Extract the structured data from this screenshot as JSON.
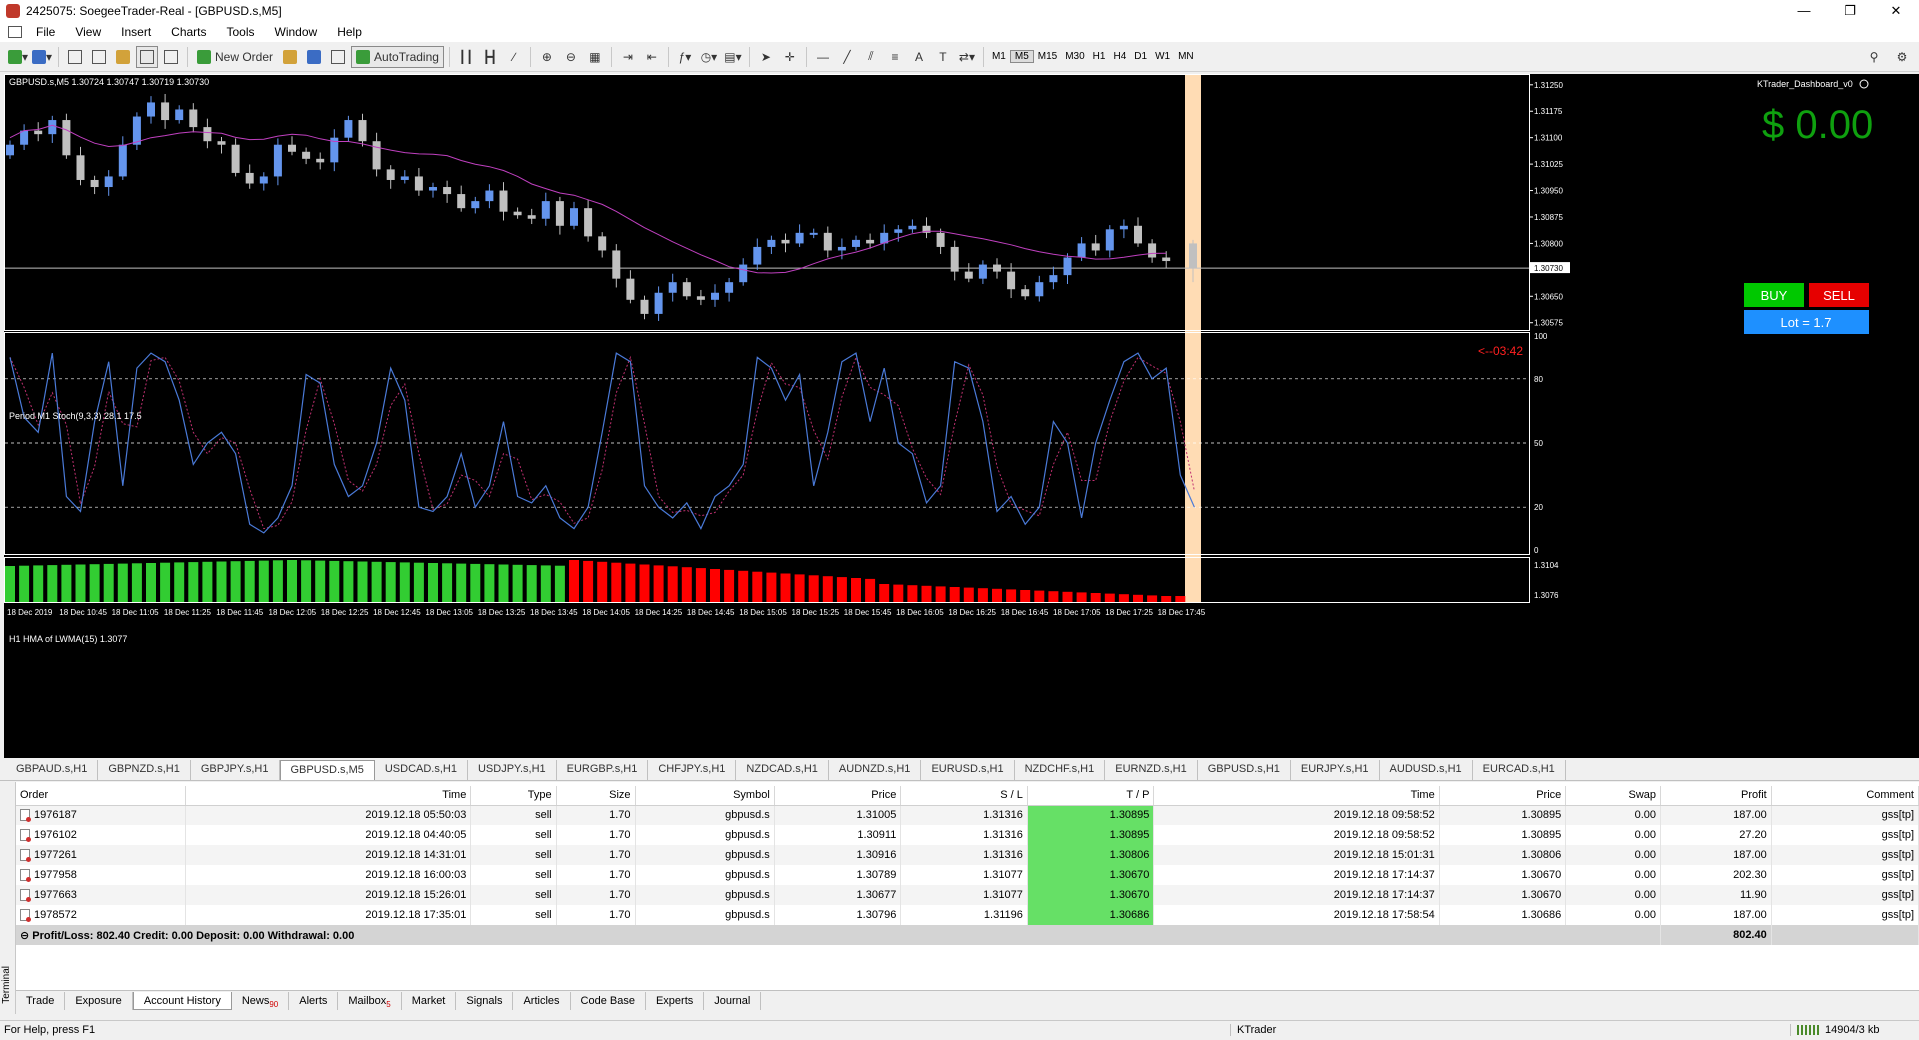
{
  "window": {
    "title": "2425075: SoegeeTrader-Real - [GBPUSD.s,M5]",
    "controls": [
      "—",
      "❐",
      "✕"
    ]
  },
  "menu": [
    "File",
    "View",
    "Insert",
    "Charts",
    "Tools",
    "Window",
    "Help"
  ],
  "toolbar": {
    "new_order": "New Order",
    "autotrading": "AutoTrading",
    "timeframes": [
      "M1",
      "M5",
      "M15",
      "M30",
      "H1",
      "H4",
      "D1",
      "W1",
      "MN"
    ],
    "active_timeframe": "M5"
  },
  "chart": {
    "header": "GBPUSD.s,M5  1.30724 1.30747 1.30719 1.30730",
    "dashboard_name": "KTrader_Dashboard_v0",
    "profit_display": "$ 0.00",
    "buy_label": "BUY",
    "sell_label": "SELL",
    "lot_label": "Lot = 1.7",
    "countdown": "<--03:42",
    "current_price": "1.30730",
    "price_ticks": [
      "1.31250",
      "1.31175",
      "1.31100",
      "1.31025",
      "1.30950",
      "1.30875",
      "1.30800",
      "1.30650",
      "1.30575"
    ],
    "stoch_label": "Period M1 Stoch(9,3,3) 28.1 17.5",
    "stoch_ticks": [
      "100",
      "80",
      "50",
      "20",
      "0"
    ],
    "hma_label": "H1 HMA of LWMA(15) 1.3077",
    "hma_ticks": [
      "1.3104",
      "1.3076"
    ],
    "time_ticks": [
      "18 Dec 2019",
      "18 Dec 10:45",
      "18 Dec 11:05",
      "18 Dec 11:25",
      "18 Dec 11:45",
      "18 Dec 12:05",
      "18 Dec 12:25",
      "18 Dec 12:45",
      "18 Dec 13:05",
      "18 Dec 13:25",
      "18 Dec 13:45",
      "18 Dec 14:05",
      "18 Dec 14:25",
      "18 Dec 14:45",
      "18 Dec 15:05",
      "18 Dec 15:25",
      "18 Dec 15:45",
      "18 Dec 16:05",
      "18 Dec 16:25",
      "18 Dec 16:45",
      "18 Dec 17:05",
      "18 Dec 17:25",
      "18 Dec 17:45"
    ],
    "colors": {
      "bull": "#6495ed",
      "bear": "#c0c0c0",
      "ma": "#c040c0",
      "stoch_main": "#4a7ad8",
      "stoch_signal": "#c03070",
      "hma_up": "#32cd32",
      "hma_down": "#ff0000",
      "highlight": "#ffdcb4"
    }
  },
  "chart_tabs": [
    "GBPAUD.s,H1",
    "GBPNZD.s,H1",
    "GBPJPY.s,H1",
    "GBPUSD.s,M5",
    "USDCAD.s,H1",
    "USDJPY.s,H1",
    "EURGBP.s,H1",
    "CHFJPY.s,H1",
    "NZDCAD.s,H1",
    "AUDNZD.s,H1",
    "EURUSD.s,H1",
    "NZDCHF.s,H1",
    "EURNZD.s,H1",
    "GBPUSD.s,H1",
    "EURJPY.s,H1",
    "AUDUSD.s,H1",
    "EURCAD.s,H1"
  ],
  "active_chart_tab": "GBPUSD.s,M5",
  "history": {
    "columns": [
      "Order",
      "Time",
      "Type",
      "Size",
      "Symbol",
      "Price",
      "S / L",
      "T / P",
      "Time",
      "Price",
      "Swap",
      "Profit",
      "Comment"
    ],
    "rows": [
      [
        "1976187",
        "2019.12.18 05:50:03",
        "sell",
        "1.70",
        "gbpusd.s",
        "1.31005",
        "1.31316",
        "1.30895",
        "2019.12.18 09:58:52",
        "1.30895",
        "0.00",
        "187.00",
        "gss[tp]"
      ],
      [
        "1976102",
        "2019.12.18 04:40:05",
        "sell",
        "1.70",
        "gbpusd.s",
        "1.30911",
        "1.31316",
        "1.30895",
        "2019.12.18 09:58:52",
        "1.30895",
        "0.00",
        "27.20",
        "gss[tp]"
      ],
      [
        "1977261",
        "2019.12.18 14:31:01",
        "sell",
        "1.70",
        "gbpusd.s",
        "1.30916",
        "1.31316",
        "1.30806",
        "2019.12.18 15:01:31",
        "1.30806",
        "0.00",
        "187.00",
        "gss[tp]"
      ],
      [
        "1977958",
        "2019.12.18 16:00:03",
        "sell",
        "1.70",
        "gbpusd.s",
        "1.30789",
        "1.31077",
        "1.30670",
        "2019.12.18 17:14:37",
        "1.30670",
        "0.00",
        "202.30",
        "gss[tp]"
      ],
      [
        "1977663",
        "2019.12.18 15:26:01",
        "sell",
        "1.70",
        "gbpusd.s",
        "1.30677",
        "1.31077",
        "1.30670",
        "2019.12.18 17:14:37",
        "1.30670",
        "0.00",
        "11.90",
        "gss[tp]"
      ],
      [
        "1978572",
        "2019.12.18 17:35:01",
        "sell",
        "1.70",
        "gbpusd.s",
        "1.30796",
        "1.31196",
        "1.30686",
        "2019.12.18 17:58:54",
        "1.30686",
        "0.00",
        "187.00",
        "gss[tp]"
      ]
    ],
    "summary": "Profit/Loss: 802.40  Credit: 0.00  Deposit: 0.00  Withdrawal: 0.00",
    "total_profit": "802.40"
  },
  "terminal_label": "Terminal",
  "bottom_tabs": [
    {
      "label": "Trade",
      "badge": ""
    },
    {
      "label": "Exposure",
      "badge": ""
    },
    {
      "label": "Account History",
      "badge": ""
    },
    {
      "label": "News",
      "badge": "90"
    },
    {
      "label": "Alerts",
      "badge": ""
    },
    {
      "label": "Mailbox",
      "badge": "5"
    },
    {
      "label": "Market",
      "badge": ""
    },
    {
      "label": "Signals",
      "badge": ""
    },
    {
      "label": "Articles",
      "badge": ""
    },
    {
      "label": "Code Base",
      "badge": ""
    },
    {
      "label": "Experts",
      "badge": ""
    },
    {
      "label": "Journal",
      "badge": ""
    }
  ],
  "active_bottom_tab": "Account History",
  "status": {
    "help": "For Help, press F1",
    "profile": "KTrader",
    "traffic": "14904/3 kb"
  }
}
